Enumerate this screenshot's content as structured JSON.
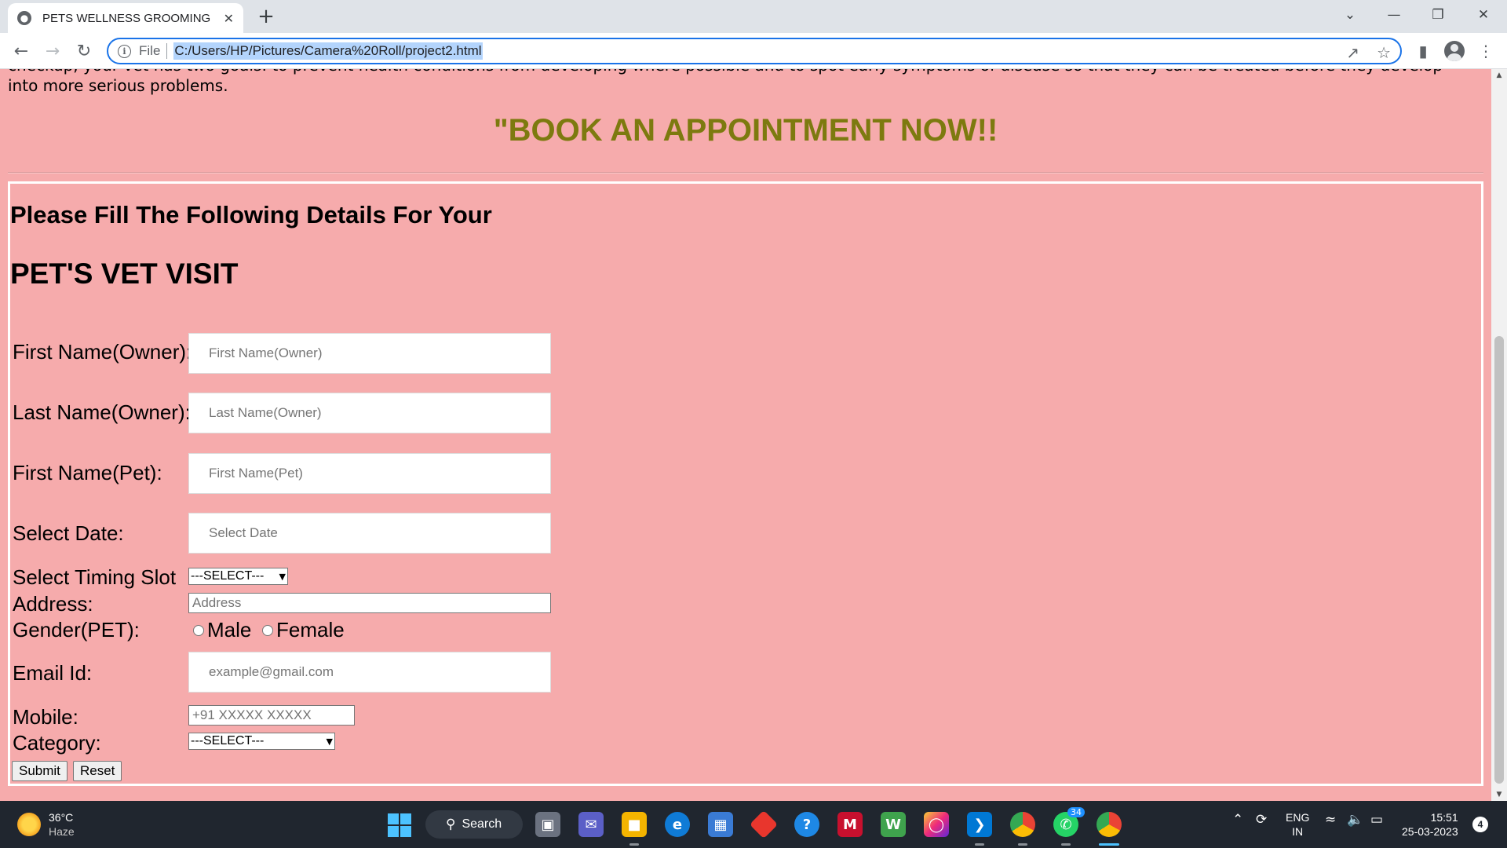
{
  "browser": {
    "tab_title": "PETS WELLNESS GROOMING",
    "url_scheme_label": "File",
    "url": "C:/Users/HP/Pictures/Camera%20Roll/project2.html"
  },
  "page": {
    "intro_line1": "checkup, your vet has two goals: to prevent health conditions from developing where possible and to spot early symptoms of disease so that they can be treated before they develop",
    "intro_line2": "into more serious problems.",
    "book_heading": "\"BOOK AN APPOINTMENT NOW!!",
    "form_subtitle": "Please Fill The Following Details For Your",
    "form_title": "PET'S VET VISIT",
    "fields": {
      "first_name_owner": {
        "label": "First Name(Owner):",
        "placeholder": "First Name(Owner)"
      },
      "last_name_owner": {
        "label": "Last Name(Owner):",
        "placeholder": "Last Name(Owner)"
      },
      "first_name_pet": {
        "label": "First Name(Pet):",
        "placeholder": "First Name(Pet)"
      },
      "select_date": {
        "label": "Select Date:",
        "placeholder": "Select Date"
      },
      "timing_slot": {
        "label": "Select Timing Slot",
        "selected": "---SELECT---"
      },
      "address": {
        "label": "Address:",
        "placeholder": "Address"
      },
      "gender": {
        "label": "Gender(PET):",
        "option_male": "Male",
        "option_female": "Female"
      },
      "email": {
        "label": "Email Id:",
        "placeholder": "example@gmail.com"
      },
      "mobile": {
        "label": "Mobile:",
        "placeholder": "+91 XXXXX XXXXX"
      },
      "category": {
        "label": "Category:",
        "selected": "---SELECT---"
      }
    },
    "buttons": {
      "submit": "Submit",
      "reset": "Reset"
    }
  },
  "taskbar": {
    "weather_temp": "36°C",
    "weather_desc": "Haze",
    "search_label": "Search",
    "whatsapp_badge": "34",
    "lang_line1": "ENG",
    "lang_line2": "IN",
    "time": "15:51",
    "date": "25-03-2023",
    "notification_count": "4"
  },
  "colors": {
    "page_background": "#f6abac",
    "heading_olive": "#7d7a0f",
    "accent_blue": "#1a73e8",
    "taskbar": "#20262f"
  }
}
